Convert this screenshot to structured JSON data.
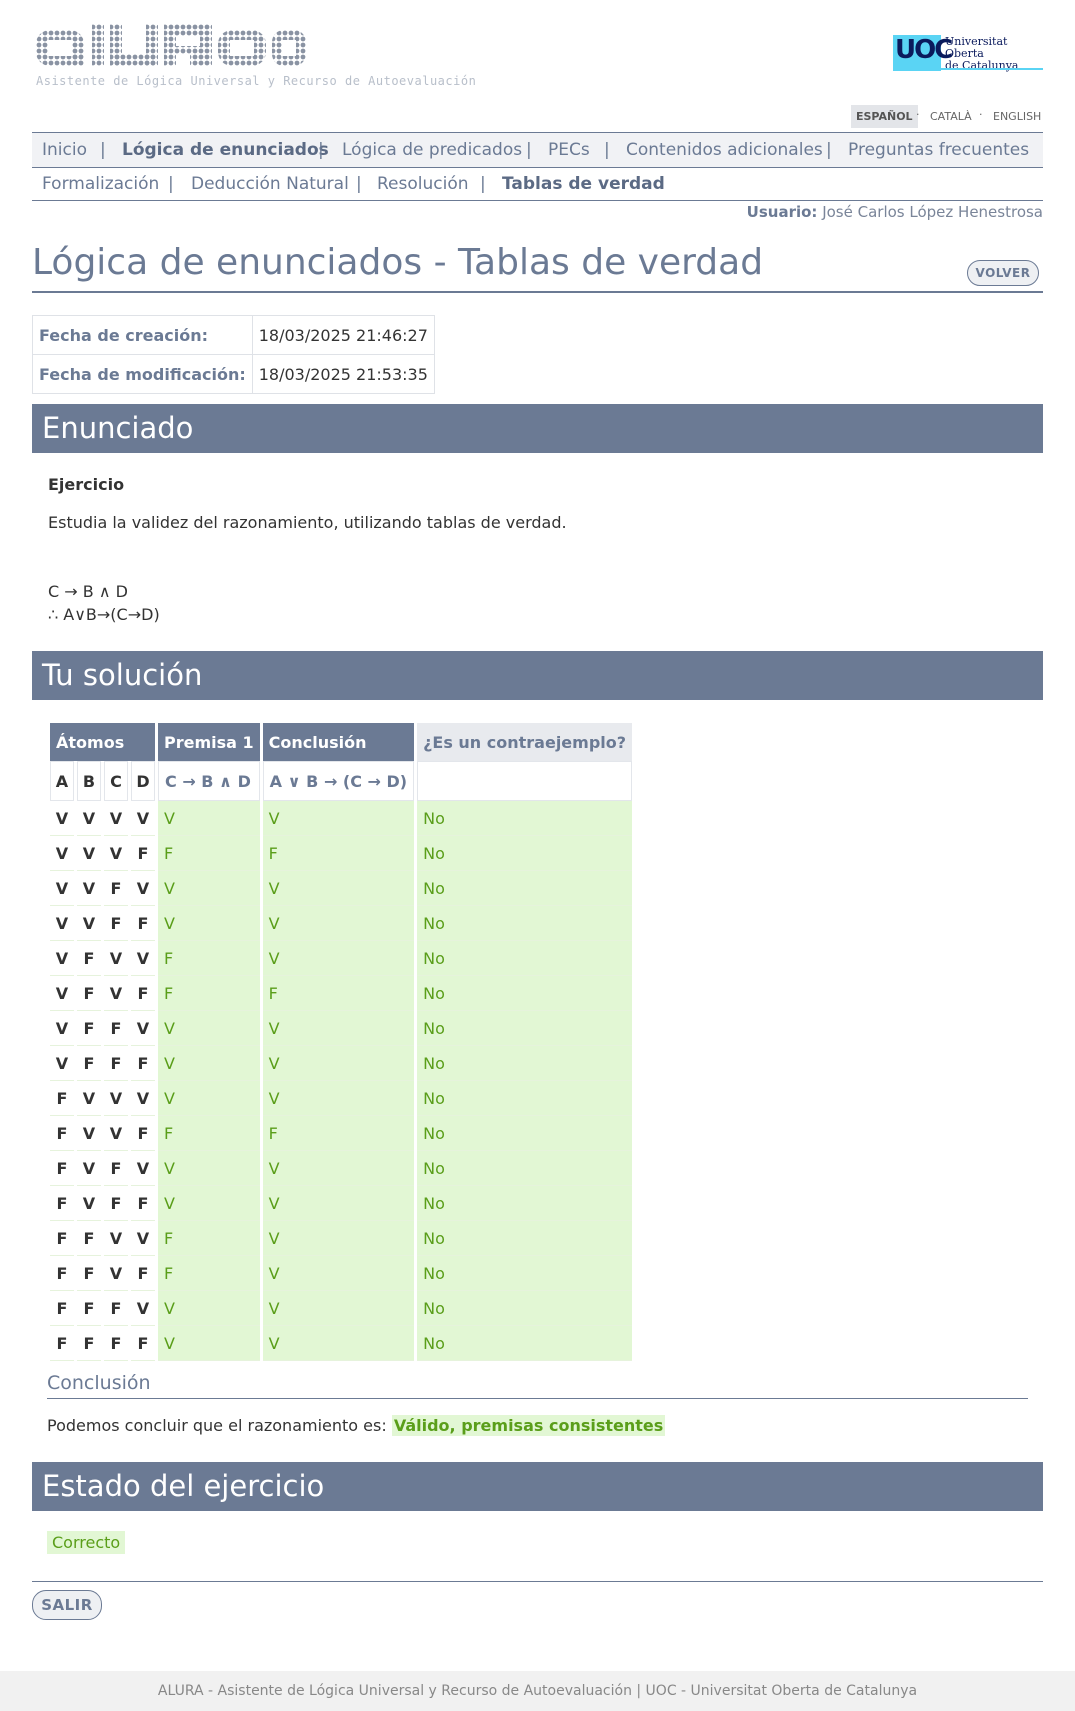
{
  "header": {
    "logo_text": "ALURA",
    "logo_subtitle": "Asistente de Lógica Universal y Recurso de Autoevaluación",
    "uoc_short": "UOC",
    "uoc_name_line1": "Universitat Oberta",
    "uoc_name_line2": "de Catalunya",
    "languages": [
      "ESPAÑOL",
      "CATALÀ",
      "ENGLISH"
    ],
    "active_language": "ESPAÑOL"
  },
  "nav": {
    "main": [
      "Inicio",
      "Lógica de enunciados",
      "Lógica de predicados",
      "PECs",
      "Contenidos adicionales",
      "Preguntas frecuentes"
    ],
    "main_active": "Lógica de enunciados",
    "sub": [
      "Formalización",
      "Deducción Natural",
      "Resolución",
      "Tablas de verdad"
    ],
    "sub_active": "Tablas de verdad",
    "separator": "|"
  },
  "user": {
    "label": "Usuario:",
    "name": "José Carlos López Henestrosa"
  },
  "page": {
    "title": "Lógica de enunciados - Tablas de verdad",
    "back_button": "VOLVER",
    "exit_button": "SALIR"
  },
  "dates": [
    {
      "label": "Fecha de creación:",
      "value": "18/03/2025 21:46:27"
    },
    {
      "label": "Fecha de modificación:",
      "value": "18/03/2025 21:53:35"
    }
  ],
  "enunciado": {
    "heading": "Enunciado",
    "exercise_label": "Ejercicio",
    "text": "Estudia la validez del razonamiento, utilizando tablas de verdad.",
    "premise": "C → B ∧ D",
    "conclusion": "∴ A∨B→(C→D)"
  },
  "solution": {
    "heading": "Tu solución",
    "headers": {
      "atoms": "Átomos",
      "premise": "Premisa 1",
      "conclusion": "Conclusión",
      "counterexample": "¿Es un contraejemplo?"
    },
    "atoms": [
      "A",
      "B",
      "C",
      "D"
    ],
    "premise_formula": "C → B ∧ D",
    "conclusion_formula": "A ∨ B → (C → D)",
    "rows": [
      {
        "a": "V",
        "b": "V",
        "c": "V",
        "d": "V",
        "p": "V",
        "c1": "V",
        "ce": "No"
      },
      {
        "a": "V",
        "b": "V",
        "c": "V",
        "d": "F",
        "p": "F",
        "c1": "F",
        "ce": "No"
      },
      {
        "a": "V",
        "b": "V",
        "c": "F",
        "d": "V",
        "p": "V",
        "c1": "V",
        "ce": "No"
      },
      {
        "a": "V",
        "b": "V",
        "c": "F",
        "d": "F",
        "p": "V",
        "c1": "V",
        "ce": "No"
      },
      {
        "a": "V",
        "b": "F",
        "c": "V",
        "d": "V",
        "p": "F",
        "c1": "V",
        "ce": "No"
      },
      {
        "a": "V",
        "b": "F",
        "c": "V",
        "d": "F",
        "p": "F",
        "c1": "F",
        "ce": "No"
      },
      {
        "a": "V",
        "b": "F",
        "c": "F",
        "d": "V",
        "p": "V",
        "c1": "V",
        "ce": "No"
      },
      {
        "a": "V",
        "b": "F",
        "c": "F",
        "d": "F",
        "p": "V",
        "c1": "V",
        "ce": "No"
      },
      {
        "a": "F",
        "b": "V",
        "c": "V",
        "d": "V",
        "p": "V",
        "c1": "V",
        "ce": "No"
      },
      {
        "a": "F",
        "b": "V",
        "c": "V",
        "d": "F",
        "p": "F",
        "c1": "F",
        "ce": "No"
      },
      {
        "a": "F",
        "b": "V",
        "c": "F",
        "d": "V",
        "p": "V",
        "c1": "V",
        "ce": "No"
      },
      {
        "a": "F",
        "b": "V",
        "c": "F",
        "d": "F",
        "p": "V",
        "c1": "V",
        "ce": "No"
      },
      {
        "a": "F",
        "b": "F",
        "c": "V",
        "d": "V",
        "p": "F",
        "c1": "V",
        "ce": "No"
      },
      {
        "a": "F",
        "b": "F",
        "c": "V",
        "d": "F",
        "p": "F",
        "c1": "V",
        "ce": "No"
      },
      {
        "a": "F",
        "b": "F",
        "c": "F",
        "d": "V",
        "p": "V",
        "c1": "V",
        "ce": "No"
      },
      {
        "a": "F",
        "b": "F",
        "c": "F",
        "d": "F",
        "p": "V",
        "c1": "V",
        "ce": "No"
      }
    ],
    "conclusion_heading": "Conclusión",
    "conclusion_text": "Podemos concluir que el razonamiento es:",
    "conclusion_value": "Válido, premisas consistentes"
  },
  "estado": {
    "heading": "Estado del ejercicio",
    "value": "Correcto"
  },
  "footer": {
    "text": "ALURA - Asistente de Lógica Universal y Recurso de Autoevaluación | UOC - Universitat Oberta de Catalunya"
  },
  "colors": {
    "accent": "#6b7a94",
    "ok_bg": "#e2f7d4",
    "ok_text": "#5a9e1a"
  }
}
